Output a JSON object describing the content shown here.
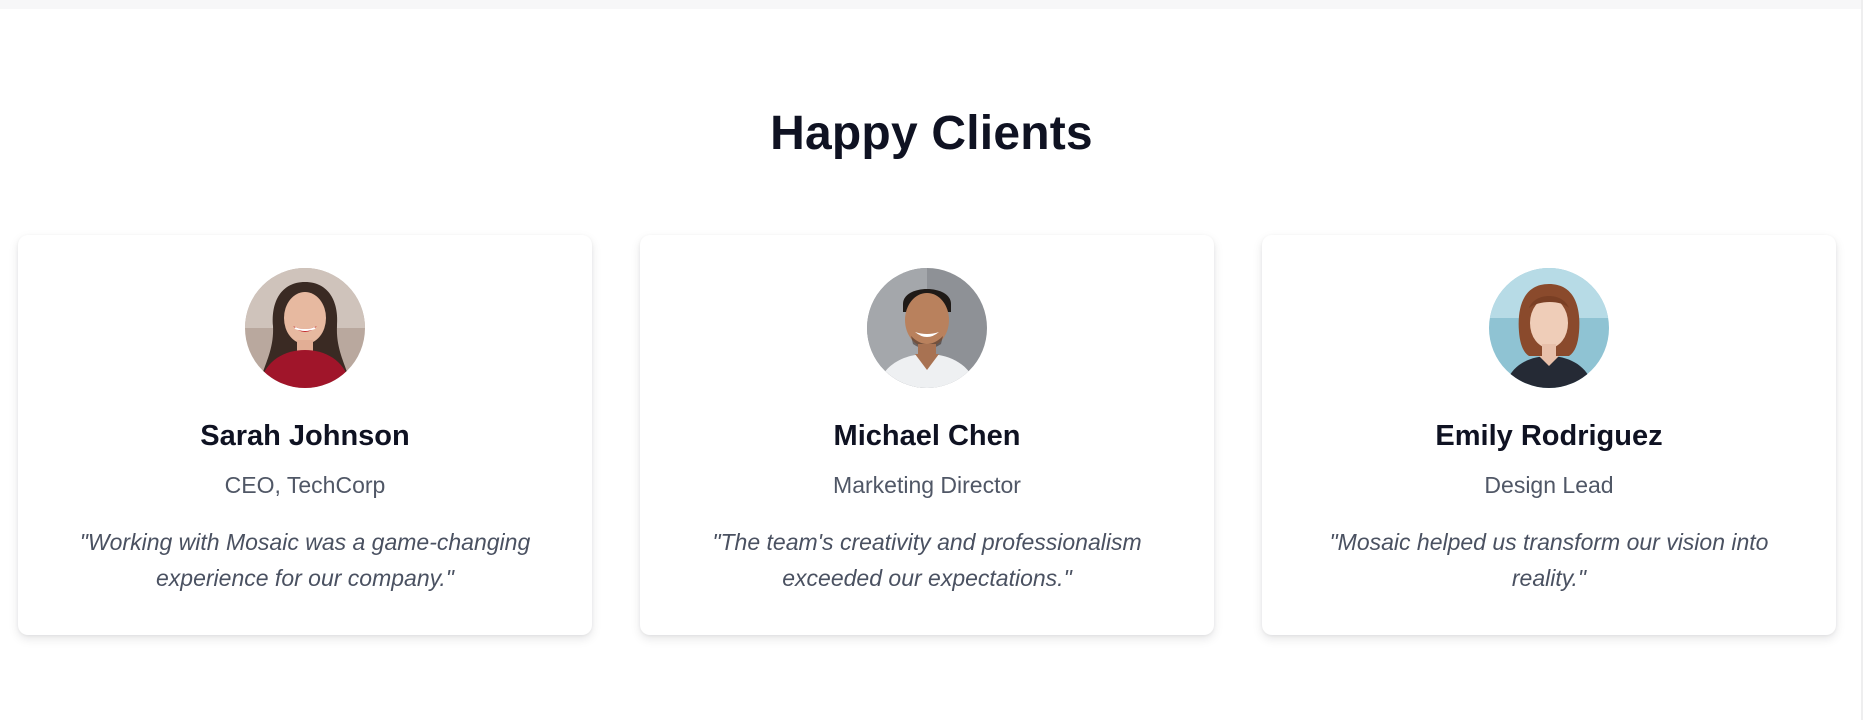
{
  "section": {
    "title": "Happy Clients"
  },
  "testimonials": [
    {
      "name": "Sarah Johnson",
      "role": "CEO, TechCorp",
      "quote": "\"Working with Mosaic was a game-changing experience for our company.\"",
      "avatar_icon": "avatar-woman-red-top"
    },
    {
      "name": "Michael Chen",
      "role": "Marketing Director",
      "quote": "\"The team's creativity and professionalism exceeded our expectations.\"",
      "avatar_icon": "avatar-man-white-shirt"
    },
    {
      "name": "Emily Rodriguez",
      "role": "Design Lead",
      "quote": "\"Mosaic helped us transform our vision into reality.\"",
      "avatar_icon": "avatar-woman-red-hair"
    }
  ],
  "colors": {
    "heading": "#0f1222",
    "muted_text": "#505766",
    "card_bg": "#ffffff"
  }
}
